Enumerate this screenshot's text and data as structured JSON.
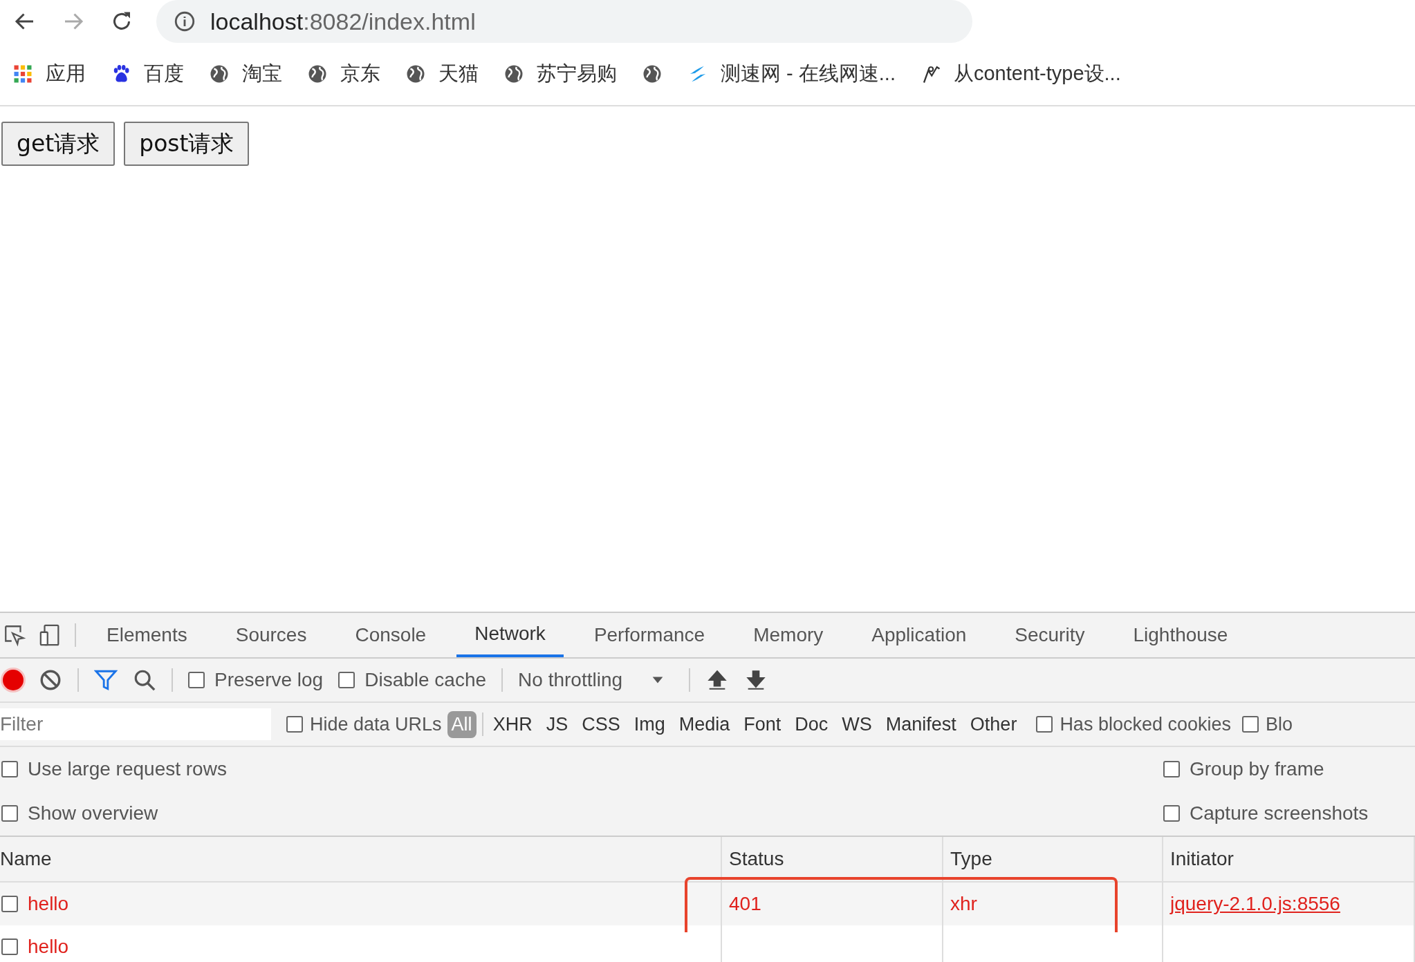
{
  "address_bar": {
    "host": "localhost",
    "path": ":8082/index.html"
  },
  "bookmarks": [
    {
      "kind": "apps",
      "label": "应用"
    },
    {
      "kind": "paw",
      "label": "百度"
    },
    {
      "kind": "globe",
      "label": "淘宝"
    },
    {
      "kind": "globe",
      "label": "京东"
    },
    {
      "kind": "globe",
      "label": "天猫"
    },
    {
      "kind": "globe",
      "label": "苏宁易购"
    },
    {
      "kind": "globe"
    },
    {
      "kind": "swirl",
      "label": "测速网 - 在线网速..."
    },
    {
      "kind": "figure",
      "label": "从content-type设..."
    }
  ],
  "page_buttons": [
    "get请求",
    "post请求"
  ],
  "devtools": {
    "tabs": [
      {
        "label": "Elements",
        "selected": false
      },
      {
        "label": "Sources",
        "selected": false
      },
      {
        "label": "Console",
        "selected": false
      },
      {
        "label": "Network",
        "selected": true
      },
      {
        "label": "Performance",
        "selected": false
      },
      {
        "label": "Memory",
        "selected": false
      },
      {
        "label": "Application",
        "selected": false
      },
      {
        "label": "Security",
        "selected": false
      },
      {
        "label": "Lighthouse",
        "selected": false
      }
    ],
    "toolbar": {
      "recording": true,
      "checkboxes": [
        {
          "label": "Preserve log",
          "checked": false
        },
        {
          "label": "Disable cache",
          "checked": false
        }
      ],
      "throttling": "No throttling"
    },
    "filter": {
      "placeholder": "Filter",
      "hide_data_urls": {
        "label": "Hide data URLs",
        "checked": false
      },
      "types": [
        {
          "label": "All",
          "selected": true
        },
        {
          "label": "XHR",
          "selected": false
        },
        {
          "label": "JS",
          "selected": false
        },
        {
          "label": "CSS",
          "selected": false
        },
        {
          "label": "Img",
          "selected": false
        },
        {
          "label": "Media",
          "selected": false
        },
        {
          "label": "Font",
          "selected": false
        },
        {
          "label": "Doc",
          "selected": false
        },
        {
          "label": "WS",
          "selected": false
        },
        {
          "label": "Manifest",
          "selected": false
        },
        {
          "label": "Other",
          "selected": false
        }
      ],
      "extra": [
        {
          "label": "Has blocked cookies",
          "checked": false
        },
        {
          "label": "Blo",
          "checked": false
        }
      ]
    },
    "options": [
      {
        "label": "Use large request rows",
        "checked": false
      },
      {
        "label": "Group by frame",
        "checked": false
      },
      {
        "label": "Show overview",
        "checked": false
      },
      {
        "label": "Capture screenshots",
        "checked": false
      }
    ],
    "table": {
      "columns": [
        "Name",
        "Status",
        "Type",
        "Initiator"
      ],
      "rows": [
        {
          "name": "hello",
          "status": "401",
          "type": "xhr",
          "initiator": "jquery-2.1.0.js:8556",
          "failed": true,
          "checked": false
        },
        {
          "name": "hello",
          "failed": true,
          "checked": false
        }
      ]
    }
  }
}
